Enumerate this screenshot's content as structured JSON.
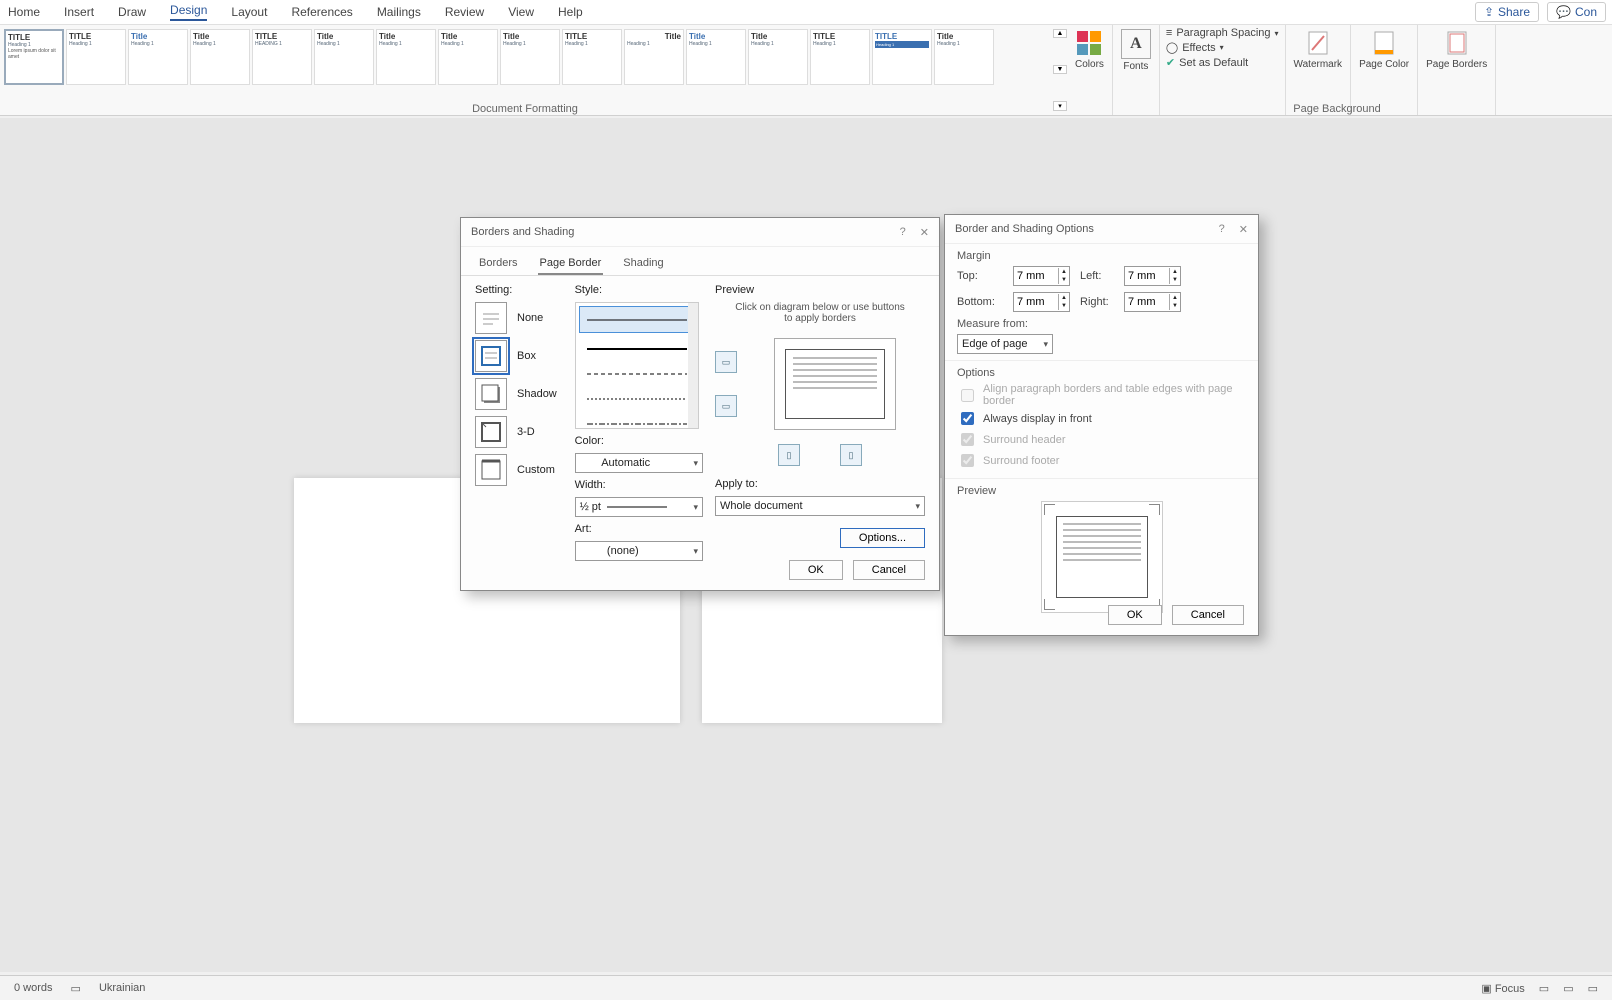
{
  "menu": {
    "items": [
      "Home",
      "Insert",
      "Draw",
      "Design",
      "Layout",
      "References",
      "Mailings",
      "Review",
      "View",
      "Help"
    ],
    "active": 3
  },
  "topright": {
    "share": "Share",
    "comments": "Con"
  },
  "ribbon": {
    "group1": "Document Formatting",
    "group2": "Page Background",
    "colors": "Colors",
    "fonts": "Fonts",
    "spacing": "Paragraph Spacing",
    "effects": "Effects",
    "setdef": "Set as Default",
    "watermark": "Watermark",
    "pagecolor": "Page Color",
    "borders": "Page Borders"
  },
  "dlg1": {
    "title": "Borders and Shading",
    "tabs": [
      "Borders",
      "Page Border",
      "Shading"
    ],
    "activeTab": 1,
    "setting": "Setting:",
    "settings": [
      {
        "l": "None"
      },
      {
        "l": "Box"
      },
      {
        "l": "Shadow"
      },
      {
        "l": "3-D"
      },
      {
        "l": "Custom"
      }
    ],
    "selSetting": 1,
    "style": "Style:",
    "color": "Color:",
    "colorVal": "Automatic",
    "width": "Width:",
    "widthVal": "½ pt",
    "art": "Art:",
    "artVal": "(none)",
    "preview": "Preview",
    "hint": "Click on diagram below or use buttons to apply borders",
    "apply": "Apply to:",
    "applyVal": "Whole document",
    "options": "Options...",
    "ok": "OK",
    "cancel": "Cancel"
  },
  "dlg2": {
    "title": "Border and Shading Options",
    "margin": "Margin",
    "top": "Top:",
    "bottom": "Bottom:",
    "left": "Left:",
    "right": "Right:",
    "val": "7 mm",
    "measure": "Measure from:",
    "measureVal": "Edge of page",
    "options": "Options",
    "o1": "Align paragraph borders and table edges with page border",
    "o2": "Always display in front",
    "o3": "Surround header",
    "o4": "Surround footer",
    "preview": "Preview",
    "ok": "OK",
    "cancel": "Cancel"
  },
  "status": {
    "words": "0 words",
    "lang": "Ukrainian",
    "focus": "Focus"
  },
  "chart_data": null
}
